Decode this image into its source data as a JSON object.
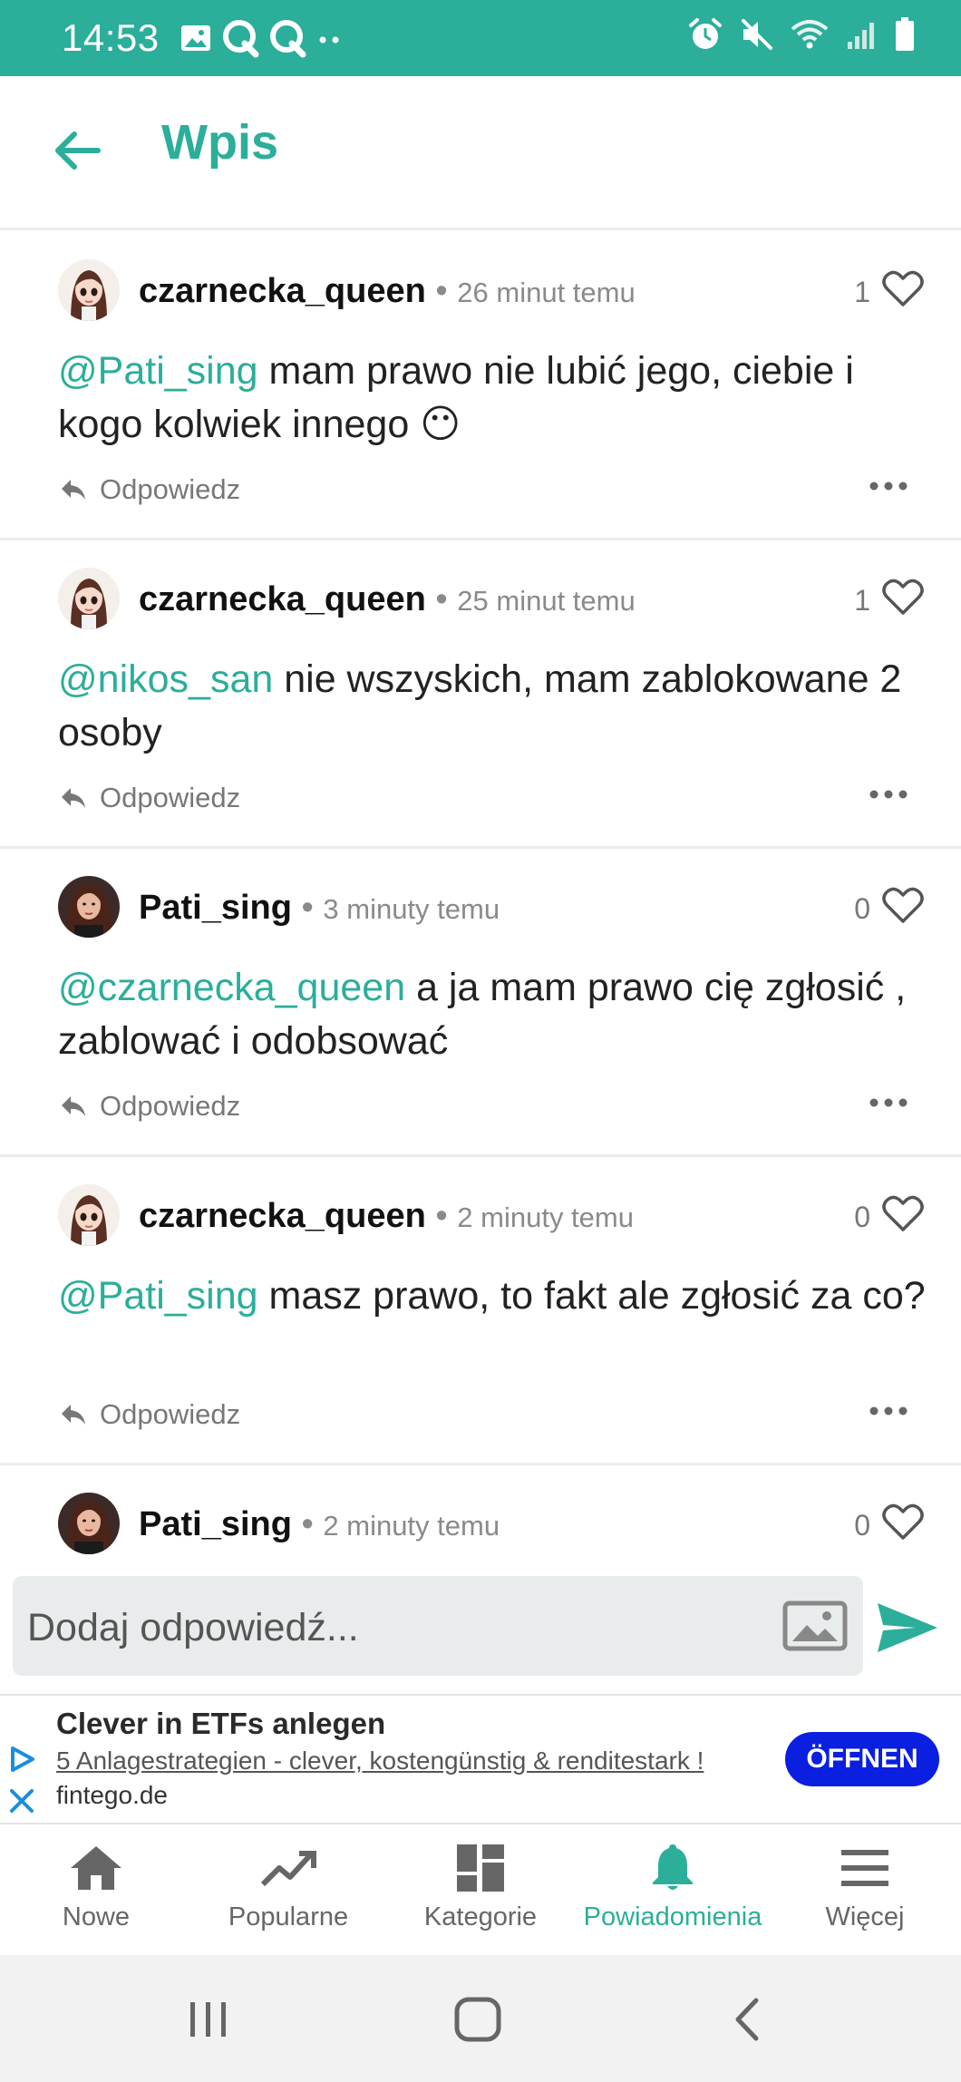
{
  "status_bar": {
    "time": "14:53",
    "left_icons": [
      "image-icon",
      "q-app-icon",
      "q-app-icon",
      "more-notifications-icon"
    ],
    "right_icons": [
      "alarm-icon",
      "mute-icon",
      "wifi-icon",
      "signal-icon",
      "battery-icon"
    ]
  },
  "header": {
    "title": "Wpis",
    "back_icon": "arrow-left-icon"
  },
  "posts": [
    {
      "username": "czarnecka_queen",
      "separator": "•",
      "time": "26 minut temu",
      "likes": "1",
      "mention": "@Pati_sing",
      "text": " mam prawo nie lubić jego, ciebie i kogo kolwiek innego 😶",
      "reply_label": "Odpowiedz",
      "avatar": "czarnecka"
    },
    {
      "username": "czarnecka_queen",
      "separator": "•",
      "time": "25 minut temu",
      "likes": "1",
      "mention": "@nikos_san",
      "text": " nie wszyskich, mam zablokowane 2 osoby",
      "reply_label": "Odpowiedz",
      "avatar": "czarnecka"
    },
    {
      "username": "Pati_sing",
      "separator": "•",
      "time": "3 minuty temu",
      "likes": "0",
      "mention": "@czarnecka_queen",
      "text": " a ja mam prawo cię zgłosić , zablować i odobsować",
      "reply_label": "Odpowiedz",
      "avatar": "pati"
    },
    {
      "username": "czarnecka_queen",
      "separator": "•",
      "time": "2 minuty temu",
      "likes": "0",
      "mention": "@Pati_sing",
      "text": " masz prawo, to fakt ale zgłosić za co?",
      "reply_label": "Odpowiedz",
      "avatar": "czarnecka"
    },
    {
      "username": "Pati_sing",
      "separator": "•",
      "time": "2 minuty temu",
      "likes": "0",
      "mention": "",
      "text": "",
      "reply_label": "",
      "avatar": "pati"
    }
  ],
  "compose": {
    "placeholder": "Dodaj odpowiedź..."
  },
  "ad": {
    "title": "Clever in ETFs anlegen",
    "description": "5 Anlagestrategien - clever, kostengünstig & renditestark !",
    "domain": "fintego.de",
    "cta": "ÖFFNEN"
  },
  "bottom_nav": {
    "items": [
      {
        "label": "Nowe",
        "icon": "home-icon",
        "active": false
      },
      {
        "label": "Popularne",
        "icon": "trending-icon",
        "active": false
      },
      {
        "label": "Kategorie",
        "icon": "categories-icon",
        "active": false
      },
      {
        "label": "Powiadomienia",
        "icon": "bell-icon",
        "active": true
      },
      {
        "label": "Więcej",
        "icon": "menu-icon",
        "active": false
      }
    ]
  },
  "colors": {
    "accent": "#2bae9a",
    "ad_cta": "#0a1fe0"
  }
}
